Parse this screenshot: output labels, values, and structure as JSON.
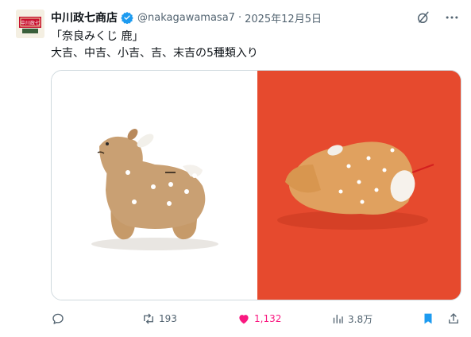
{
  "author": {
    "name": "中川政七商店",
    "handle": "@nakagawamasa7",
    "separator": "·",
    "date": "2025年12月5日",
    "verified": true
  },
  "avatar_text": "中川政七",
  "post_text": [
    "「奈良みくじ 鹿」",
    "大吉、中吉、小吉、吉、末吉の5種類入り"
  ],
  "media": {
    "count": 2,
    "left_background": "#ffffff",
    "right_background": "#e64a2e"
  },
  "actions": {
    "replies": "",
    "reposts": "193",
    "likes": "1,132",
    "views": "3.8万"
  },
  "colors": {
    "text": "#0f1419",
    "secondary": "#536471",
    "verified": "#1d9bf0",
    "like": "#f91880",
    "bookmark": "#1d9bf0"
  },
  "icons": [
    "grok-icon",
    "more-icon",
    "reply-icon",
    "repost-icon",
    "like-icon",
    "views-icon",
    "bookmark-icon",
    "share-icon"
  ]
}
